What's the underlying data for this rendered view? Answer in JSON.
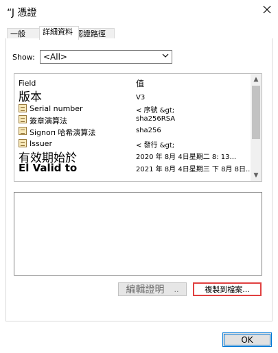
{
  "window": {
    "title": "“J 憑證",
    "close_icon": "close-icon"
  },
  "tabs": [
    {
      "label": "一般"
    },
    {
      "label": "詳細資料"
    },
    {
      "label": "認證路徑"
    }
  ],
  "show": {
    "label": "Show:",
    "value": "<All>"
  },
  "list": {
    "headers": {
      "field": "Field",
      "value": "值"
    },
    "rows": [
      {
        "field": "版本",
        "value": "V3",
        "large": true
      },
      {
        "field": "Serial number",
        "value": "< 序號 &gt;"
      },
      {
        "field": "簽章演算法",
        "value": "sha256RSA"
      },
      {
        "field": "Signoп 哈希演算法",
        "value": "sha256"
      },
      {
        "field": "Issuer",
        "value": "< 發行 &gt;"
      },
      {
        "field": "有效期始於",
        "value": "2020 年 8月 4日星期二 8: 13...",
        "large": true
      },
      {
        "field": "El Valid to",
        "value": "2021 年 8月 4日星期三 下 8月 8日...",
        "large": true
      }
    ]
  },
  "buttons": {
    "edit_label": "編輯證明",
    "edit_suffix": "..",
    "copy_label": "複製到檔案...",
    "ok_label": "OK"
  },
  "colors": {
    "accent": "#0078d7",
    "highlight": "#e04040"
  }
}
